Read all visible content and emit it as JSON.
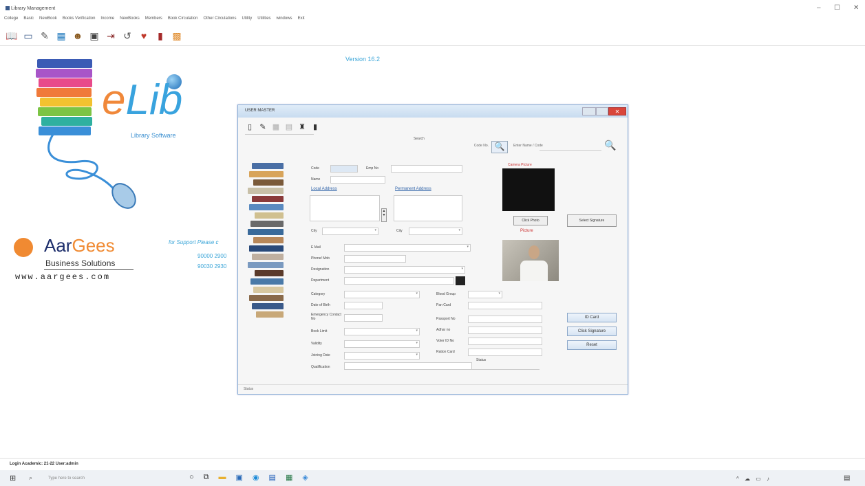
{
  "app": {
    "title": "Library Management"
  },
  "menu": [
    "College",
    "Basic",
    "NewBook",
    "Books Verification",
    "Income",
    "NewBooks",
    "Members",
    "Book Circulation",
    "Other Circulations",
    "Utility",
    "Utilities",
    "windows",
    "Exit"
  ],
  "toolbar_icons": [
    "book-icon",
    "window-icon",
    "tools-icon",
    "chart-icon",
    "reader-icon",
    "card-icon",
    "issue-icon",
    "return-icon",
    "heart-book-icon",
    "book-red-icon",
    "exit-icon"
  ],
  "main": {
    "version": "Version 16.2",
    "logo_e": "e",
    "logo_lib": "Lib",
    "tagline": "Library Software",
    "company_aar": "Aar",
    "company_gees": "Gees",
    "company_sub": "Business Solutions",
    "company_url": "www.aargees.com",
    "support_text": "for Support Please c",
    "support_phone1": "90000 2900",
    "support_phone2": "90030 2930"
  },
  "dialog": {
    "title": "USER MASTER",
    "search_label": "Search",
    "search_code_placeholder": "Code No.",
    "search_name_placeholder": "Enter Name / Code",
    "labels": {
      "code": "Code",
      "emp_no": "Emp No",
      "name": "Name",
      "local_address": "Local Address",
      "permanent_address": "Permanent Address",
      "city": "City",
      "city2": "City",
      "email": "E Mail",
      "phone": "Phone/ Mob",
      "designation": "Designation",
      "department": "Department",
      "category": "Category",
      "dob": "Date of Birth",
      "emergency": "Emergency Contact No",
      "book_limit": "Book Limit",
      "validity": "Validity",
      "joining_date": "Joining Date",
      "qualification": "Qualification",
      "blood_group": "Blood Group",
      "pan": "Pan Card",
      "passport": "Passport No",
      "adhar": "Adhar no",
      "voter": "Voter ID No",
      "ration": "Ration Card",
      "status": "Status",
      "camera_picture": "Camera Picture",
      "picture": "Picture"
    },
    "values": {
      "code": "",
      "name": "",
      "local_address": "",
      "permanent_address": "",
      "city": "",
      "city2": "",
      "email": "",
      "phone": "",
      "designation": "",
      "department": "",
      "category": "",
      "dob": "",
      "emergency": "",
      "book_limit": "",
      "validity": "",
      "joining_date": "",
      "blood_group": "",
      "pan": ""
    },
    "email_note": "",
    "age_note": "",
    "buttons": {
      "click_photo": "Click Photo",
      "select_signature": "Select Signature",
      "id_card": "ID Card",
      "click_signature": "Click Signature",
      "reset": "Reset"
    },
    "help_text": "",
    "statusbar": "Status"
  },
  "statusbar": {
    "left": "Login Academic: 21-22  User:admin",
    "college": "",
    "date": ""
  },
  "taskbar": {
    "search_placeholder": "Type here to search",
    "weather": "",
    "lang": "",
    "time": "",
    "date": ""
  },
  "colors": {
    "accent": "#3aa5d8",
    "orange": "#f08a32",
    "navy": "#1c2d6b"
  }
}
